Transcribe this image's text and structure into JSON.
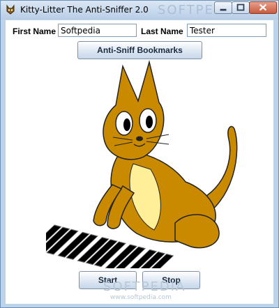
{
  "window": {
    "title": "Kitty-Litter The Anti-Sniffer 2.0",
    "min_icon": "minimize-icon",
    "max_icon": "maximize-icon",
    "close_icon": "close-icon"
  },
  "form": {
    "first_name_label": "First Name",
    "first_name_value": "Softpedia",
    "last_name_label": "Last Name",
    "last_name_value": "Tester"
  },
  "buttons": {
    "bookmarks": "Anti-Sniff Bookmarks",
    "start": "Start",
    "stop": "Stop"
  },
  "watermark": {
    "top_text": "SOFTPEDIA",
    "bottom_text": "SOFTPEDIA",
    "url_text": "www.softpedia.com"
  },
  "colors": {
    "cat_body": "#c98a00",
    "cat_belly": "#ffef99",
    "titlebar": "#c9daee"
  }
}
